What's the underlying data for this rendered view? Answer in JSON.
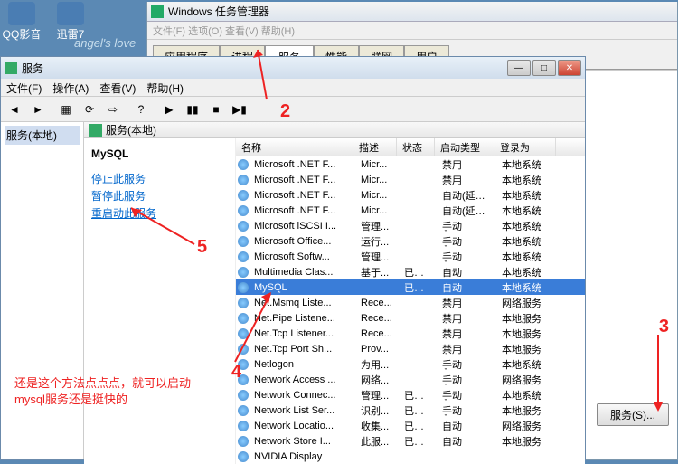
{
  "desktop": {
    "icons": [
      "QQ影音",
      "迅雷7"
    ],
    "wallpaper_text": "angel's love"
  },
  "taskmgr": {
    "title": "Windows 任务管理器",
    "menu": "文件(F)  选项(O)  查看(V)  帮助(H)",
    "tabs": [
      "应用程序",
      "进程",
      "服务",
      "性能",
      "联网",
      "用户"
    ],
    "active_tab": 2
  },
  "services_win": {
    "title": "服务",
    "menu": [
      "文件(F)",
      "操作(A)",
      "查看(V)",
      "帮助(H)"
    ],
    "left_item": "服务(本地)",
    "right_head": "服务(本地)",
    "detail": {
      "name": "MySQL",
      "actions": [
        "停止此服务",
        "暂停此服务",
        "重启动此服务"
      ]
    },
    "columns": [
      "名称",
      "描述",
      "状态",
      "启动类型",
      "登录为"
    ],
    "rows": [
      {
        "name": "Microsoft .NET F...",
        "desc": "Micr...",
        "status": "",
        "start": "禁用",
        "user": "本地系统"
      },
      {
        "name": "Microsoft .NET F...",
        "desc": "Micr...",
        "status": "",
        "start": "禁用",
        "user": "本地系统"
      },
      {
        "name": "Microsoft .NET F...",
        "desc": "Micr...",
        "status": "",
        "start": "自动(延迟...",
        "user": "本地系统"
      },
      {
        "name": "Microsoft .NET F...",
        "desc": "Micr...",
        "status": "",
        "start": "自动(延迟...",
        "user": "本地系统"
      },
      {
        "name": "Microsoft iSCSI I...",
        "desc": "管理...",
        "status": "",
        "start": "手动",
        "user": "本地系统"
      },
      {
        "name": "Microsoft Office...",
        "desc": "运行...",
        "status": "",
        "start": "手动",
        "user": "本地系统"
      },
      {
        "name": "Microsoft Softw...",
        "desc": "管理...",
        "status": "",
        "start": "手动",
        "user": "本地系统"
      },
      {
        "name": "Multimedia Clas...",
        "desc": "基于...",
        "status": "已启动",
        "start": "自动",
        "user": "本地系统"
      },
      {
        "name": "MySQL",
        "desc": "",
        "status": "已启动",
        "start": "自动",
        "user": "本地系统",
        "selected": true
      },
      {
        "name": "Net.Msmq Liste...",
        "desc": "Rece...",
        "status": "",
        "start": "禁用",
        "user": "网络服务"
      },
      {
        "name": "Net.Pipe Listene...",
        "desc": "Rece...",
        "status": "",
        "start": "禁用",
        "user": "本地服务"
      },
      {
        "name": "Net.Tcp Listener...",
        "desc": "Rece...",
        "status": "",
        "start": "禁用",
        "user": "本地服务"
      },
      {
        "name": "Net.Tcp Port Sh...",
        "desc": "Prov...",
        "status": "",
        "start": "禁用",
        "user": "本地服务"
      },
      {
        "name": "Netlogon",
        "desc": "为用...",
        "status": "",
        "start": "手动",
        "user": "本地系统"
      },
      {
        "name": "Network Access ...",
        "desc": "网络...",
        "status": "",
        "start": "手动",
        "user": "网络服务"
      },
      {
        "name": "Network Connec...",
        "desc": "管理...",
        "status": "已启动",
        "start": "手动",
        "user": "本地系统"
      },
      {
        "name": "Network List Ser...",
        "desc": "识别...",
        "status": "已启动",
        "start": "手动",
        "user": "本地服务"
      },
      {
        "name": "Network Locatio...",
        "desc": "收集...",
        "status": "已启动",
        "start": "自动",
        "user": "网络服务"
      },
      {
        "name": "Network Store I...",
        "desc": "此服...",
        "status": "已启动",
        "start": "自动",
        "user": "本地服务"
      },
      {
        "name": "NVIDIA Display",
        "desc": "",
        "status": "",
        "start": "",
        "user": ""
      }
    ]
  },
  "annotations": {
    "n2": "2",
    "n3": "3",
    "n4": "4",
    "n5": "5",
    "note": "还是这个方法点点点，就可以启动\nmysql服务还是挺快的"
  },
  "bottom_button": "服务(S)..."
}
